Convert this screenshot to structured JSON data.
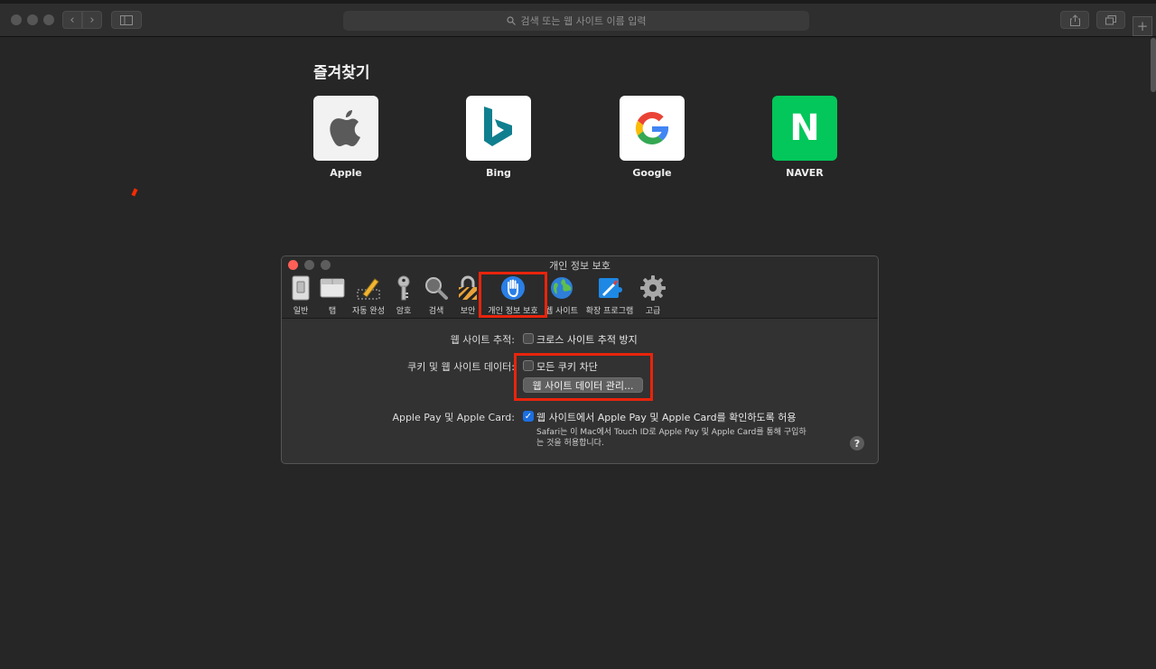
{
  "browser": {
    "address_placeholder": "검색 또는 웹 사이트 이름 입력"
  },
  "favorites": {
    "title": "즐겨찾기",
    "items": [
      {
        "label": "Apple",
        "icon": "apple-logo-icon"
      },
      {
        "label": "Bing",
        "icon": "bing-logo-icon"
      },
      {
        "label": "Google",
        "icon": "google-logo-icon"
      },
      {
        "label": "NAVER",
        "icon": "naver-logo-icon",
        "letter": "N"
      }
    ]
  },
  "prefs": {
    "title": "개인 정보 보호",
    "tabs": [
      {
        "label": "일반",
        "icon": "switch-icon"
      },
      {
        "label": "탭",
        "icon": "tabs-icon"
      },
      {
        "label": "자동 완성",
        "icon": "pencil-icon"
      },
      {
        "label": "암호",
        "icon": "key-icon"
      },
      {
        "label": "검색",
        "icon": "magnifier-icon"
      },
      {
        "label": "보안",
        "icon": "padlock-icon"
      },
      {
        "label": "개인 정보 보호",
        "icon": "hand-icon",
        "selected": true
      },
      {
        "label": "웹 사이트",
        "icon": "globe-icon"
      },
      {
        "label": "확장 프로그램",
        "icon": "puzzle-icon"
      },
      {
        "label": "고급",
        "icon": "gear-icon"
      }
    ],
    "tracking_label": "웹 사이트 추적:",
    "tracking_option": "크로스 사이트 추적 방지",
    "cookies_label": "쿠키 및 웹 사이트 데이터:",
    "cookies_option": "모든 쿠키 차단",
    "manage_button": "웹 사이트 데이터 관리...",
    "applepay_label": "Apple Pay 및 Apple Card:",
    "applepay_option": "웹 사이트에서 Apple Pay 및 Apple Card를 확인하도록 허용",
    "applepay_note": "Safari는 이 Mac에서 Touch ID로 Apple Pay 및 Apple Card를 통해 구입하는 것을 허용합니다.",
    "help": "?"
  },
  "colors": {
    "highlight": "#e8240c",
    "checkbox_checked": "#1c6fe0",
    "naver_green": "#03c75a"
  }
}
